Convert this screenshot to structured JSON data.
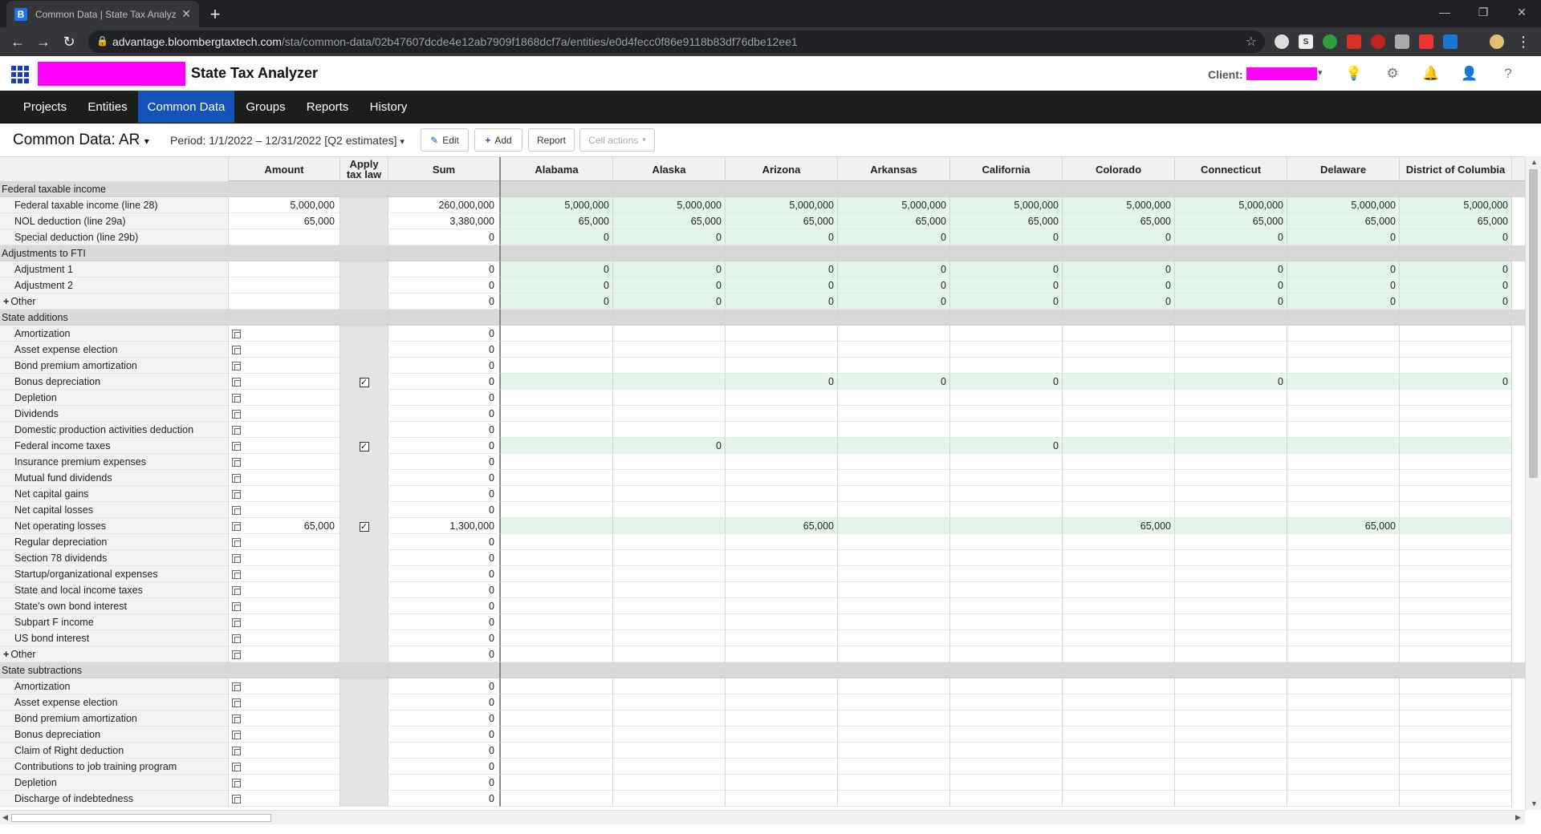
{
  "browser": {
    "tab_title": "Common Data | State Tax Analyzer",
    "tab_favicon": "B",
    "url_host": "advantage.bloombergtaxtech.com",
    "url_path": "/sta/common-data/02b47607dcde4e12ab7909f1868dcf7a/entities/e0d4fecc0f86e9118b83df76dbe12ee1"
  },
  "app": {
    "title": "State Tax Analyzer",
    "client_label": "Client:",
    "brand_color": "#ff00ff"
  },
  "nav": {
    "items": [
      {
        "label": "Projects"
      },
      {
        "label": "Entities"
      },
      {
        "label": "Common Data",
        "active": true
      },
      {
        "label": "Groups"
      },
      {
        "label": "Reports"
      },
      {
        "label": "History"
      }
    ]
  },
  "toolbar": {
    "title": "Common Data: AR",
    "period": "Period: 1/1/2022 – 12/31/2022 [Q2 estimates]",
    "edit": "Edit",
    "add": "Add",
    "report": "Report",
    "cell_actions": "Cell actions"
  },
  "columns": {
    "amount": "Amount",
    "apply_tax_law": "Apply tax law",
    "sum": "Sum",
    "states": [
      "Alabama",
      "Alaska",
      "Arizona",
      "Arkansas",
      "California",
      "Colorado",
      "Connecticut",
      "Delaware",
      "District of Columbia"
    ]
  },
  "rows": [
    {
      "type": "section",
      "label": "Federal taxable income"
    },
    {
      "label": "Federal taxable income (line 28)",
      "amount": "5,000,000",
      "sum": "260,000,000",
      "green": true,
      "states": [
        "5,000,000",
        "5,000,000",
        "5,000,000",
        "5,000,000",
        "5,000,000",
        "5,000,000",
        "5,000,000",
        "5,000,000",
        "5,000,000"
      ]
    },
    {
      "label": "NOL deduction (line 29a)",
      "amount": "65,000",
      "sum": "3,380,000",
      "green": true,
      "states": [
        "65,000",
        "65,000",
        "65,000",
        "65,000",
        "65,000",
        "65,000",
        "65,000",
        "65,000",
        "65,000"
      ]
    },
    {
      "label": "Special deduction (line 29b)",
      "amount": "",
      "sum": "0",
      "green": true,
      "states": [
        "0",
        "0",
        "0",
        "0",
        "0",
        "0",
        "0",
        "0",
        "0"
      ]
    },
    {
      "type": "section",
      "label": "Adjustments to FTI"
    },
    {
      "label": "Adjustment 1",
      "amount": "",
      "sum": "0",
      "green": true,
      "states": [
        "0",
        "0",
        "0",
        "0",
        "0",
        "0",
        "0",
        "0",
        "0"
      ]
    },
    {
      "label": "Adjustment 2",
      "amount": "",
      "sum": "0",
      "green": true,
      "states": [
        "0",
        "0",
        "0",
        "0",
        "0",
        "0",
        "0",
        "0",
        "0"
      ]
    },
    {
      "label": "Other",
      "expand": true,
      "amount": "",
      "sum": "0",
      "green": true,
      "states": [
        "0",
        "0",
        "0",
        "0",
        "0",
        "0",
        "0",
        "0",
        "0"
      ]
    },
    {
      "type": "section",
      "label": "State additions"
    },
    {
      "label": "Amortization",
      "copy": true,
      "sum": "0",
      "states": [
        "",
        "",
        "",
        "",
        "",
        "",
        "",
        "",
        ""
      ]
    },
    {
      "label": "Asset expense election",
      "copy": true,
      "sum": "0",
      "states": [
        "",
        "",
        "",
        "",
        "",
        "",
        "",
        "",
        ""
      ]
    },
    {
      "label": "Bond premium amortization",
      "copy": true,
      "sum": "0",
      "states": [
        "",
        "",
        "",
        "",
        "",
        "",
        "",
        "",
        ""
      ]
    },
    {
      "label": "Bonus depreciation",
      "copy": true,
      "tax": true,
      "sum": "0",
      "green": true,
      "states": [
        "",
        "",
        "0",
        "0",
        "0",
        "",
        "0",
        "",
        "0"
      ]
    },
    {
      "label": "Depletion",
      "copy": true,
      "sum": "0",
      "states": [
        "",
        "",
        "",
        "",
        "",
        "",
        "",
        "",
        ""
      ]
    },
    {
      "label": "Dividends",
      "copy": true,
      "sum": "0",
      "states": [
        "",
        "",
        "",
        "",
        "",
        "",
        "",
        "",
        ""
      ]
    },
    {
      "label": "Domestic production activities deduction",
      "copy": true,
      "sum": "0",
      "states": [
        "",
        "",
        "",
        "",
        "",
        "",
        "",
        "",
        ""
      ]
    },
    {
      "label": "Federal income taxes",
      "copy": true,
      "tax": true,
      "sum": "0",
      "green": true,
      "states": [
        "",
        "0",
        "",
        "",
        "0",
        "",
        "",
        "",
        ""
      ]
    },
    {
      "label": "Insurance premium expenses",
      "copy": true,
      "sum": "0",
      "states": [
        "",
        "",
        "",
        "",
        "",
        "",
        "",
        "",
        ""
      ]
    },
    {
      "label": "Mutual fund dividends",
      "copy": true,
      "sum": "0",
      "states": [
        "",
        "",
        "",
        "",
        "",
        "",
        "",
        "",
        ""
      ]
    },
    {
      "label": "Net capital gains",
      "copy": true,
      "sum": "0",
      "states": [
        "",
        "",
        "",
        "",
        "",
        "",
        "",
        "",
        ""
      ]
    },
    {
      "label": "Net capital losses",
      "copy": true,
      "sum": "0",
      "states": [
        "",
        "",
        "",
        "",
        "",
        "",
        "",
        "",
        ""
      ]
    },
    {
      "label": "Net operating losses",
      "copy": true,
      "amount": "65,000",
      "tax": true,
      "sum": "1,300,000",
      "green": true,
      "states": [
        "",
        "",
        "65,000",
        "",
        "",
        "65,000",
        "",
        "65,000",
        ""
      ]
    },
    {
      "label": "Regular depreciation",
      "copy": true,
      "sum": "0",
      "states": [
        "",
        "",
        "",
        "",
        "",
        "",
        "",
        "",
        ""
      ]
    },
    {
      "label": "Section 78 dividends",
      "copy": true,
      "sum": "0",
      "states": [
        "",
        "",
        "",
        "",
        "",
        "",
        "",
        "",
        ""
      ]
    },
    {
      "label": "Startup/organizational expenses",
      "copy": true,
      "sum": "0",
      "states": [
        "",
        "",
        "",
        "",
        "",
        "",
        "",
        "",
        ""
      ]
    },
    {
      "label": "State and local income taxes",
      "copy": true,
      "sum": "0",
      "states": [
        "",
        "",
        "",
        "",
        "",
        "",
        "",
        "",
        ""
      ]
    },
    {
      "label": "State's own bond interest",
      "copy": true,
      "sum": "0",
      "states": [
        "",
        "",
        "",
        "",
        "",
        "",
        "",
        "",
        ""
      ]
    },
    {
      "label": "Subpart F income",
      "copy": true,
      "sum": "0",
      "states": [
        "",
        "",
        "",
        "",
        "",
        "",
        "",
        "",
        ""
      ]
    },
    {
      "label": "US bond interest",
      "copy": true,
      "sum": "0",
      "states": [
        "",
        "",
        "",
        "",
        "",
        "",
        "",
        "",
        ""
      ]
    },
    {
      "label": "Other",
      "expand": true,
      "copy": true,
      "sum": "0",
      "states": [
        "",
        "",
        "",
        "",
        "",
        "",
        "",
        "",
        ""
      ]
    },
    {
      "type": "section",
      "label": "State subtractions"
    },
    {
      "label": "Amortization",
      "copy": true,
      "sum": "0",
      "states": [
        "",
        "",
        "",
        "",
        "",
        "",
        "",
        "",
        ""
      ]
    },
    {
      "label": "Asset expense election",
      "copy": true,
      "sum": "0",
      "states": [
        "",
        "",
        "",
        "",
        "",
        "",
        "",
        "",
        ""
      ]
    },
    {
      "label": "Bond premium amortization",
      "copy": true,
      "sum": "0",
      "states": [
        "",
        "",
        "",
        "",
        "",
        "",
        "",
        "",
        ""
      ]
    },
    {
      "label": "Bonus depreciation",
      "copy": true,
      "sum": "0",
      "states": [
        "",
        "",
        "",
        "",
        "",
        "",
        "",
        "",
        ""
      ]
    },
    {
      "label": "Claim of Right deduction",
      "copy": true,
      "sum": "0",
      "states": [
        "",
        "",
        "",
        "",
        "",
        "",
        "",
        "",
        ""
      ]
    },
    {
      "label": "Contributions to job training program",
      "copy": true,
      "sum": "0",
      "states": [
        "",
        "",
        "",
        "",
        "",
        "",
        "",
        "",
        ""
      ]
    },
    {
      "label": "Depletion",
      "copy": true,
      "sum": "0",
      "states": [
        "",
        "",
        "",
        "",
        "",
        "",
        "",
        "",
        ""
      ]
    },
    {
      "label": "Discharge of indebtedness",
      "copy": true,
      "sum": "0",
      "states": [
        "",
        "",
        "",
        "",
        "",
        "",
        "",
        "",
        ""
      ]
    }
  ]
}
